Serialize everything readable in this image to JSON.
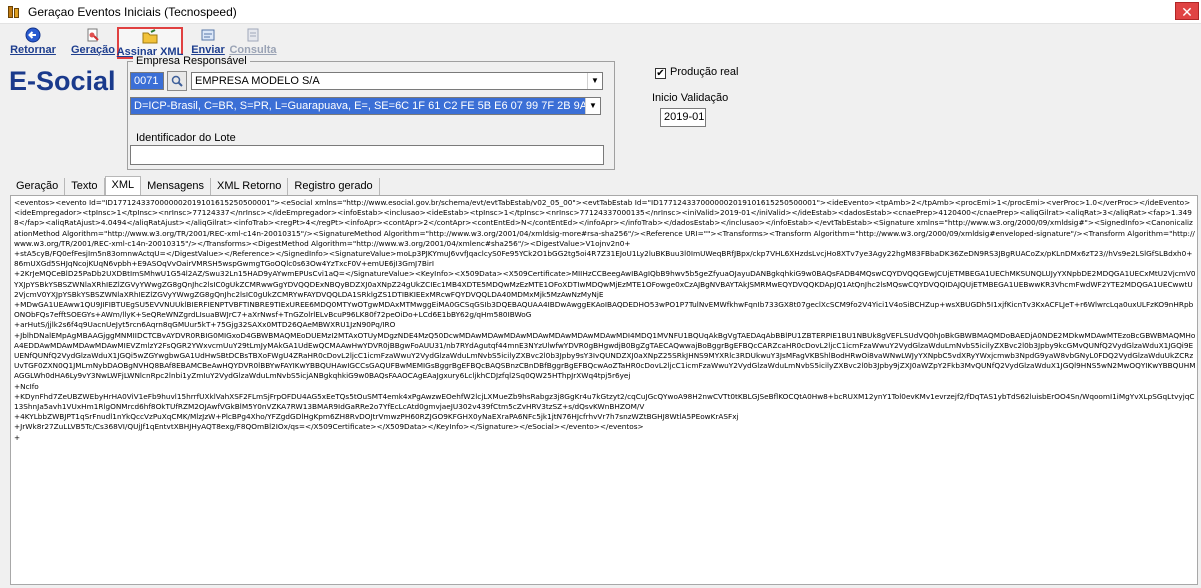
{
  "window": {
    "title": "Geraçao Eventos Iniciais (Tecnospeed)",
    "close_glyph": "✕"
  },
  "toolbar": {
    "buttons": [
      {
        "label": "Retornar",
        "icon": "back-arrow-icon",
        "state": "normal"
      },
      {
        "label": "Geração",
        "icon": "generate-icon",
        "state": "normal"
      },
      {
        "label": "Assinar XML",
        "icon": "folder-sign-icon",
        "state": "selected"
      },
      {
        "label": "Enviar",
        "icon": "send-icon",
        "state": "normal"
      },
      {
        "label": "Consulta",
        "icon": "query-icon",
        "state": "disabled"
      }
    ]
  },
  "logo": "E-Social",
  "empresa": {
    "legend": "Empresa Responsável",
    "code": "0071",
    "company": "EMPRESA MODELO S/A",
    "certificate": "D=ICP-Brasil, C=BR, S=PR, L=Guarapuava, E=, SE=6C 1F 61 C2 FE 5B E6 07 99 7F 2B 9A 38 96 B2 BE",
    "lote_label": "Identificador do Lote",
    "lote_value": ""
  },
  "producao": {
    "checked_glyph": "✔",
    "label": "Produção real"
  },
  "inicio": {
    "label": "Inicio Validação",
    "value": "2019-01"
  },
  "tabs": [
    {
      "label": "Geração",
      "active": false
    },
    {
      "label": "Texto",
      "active": false
    },
    {
      "label": "XML",
      "active": true
    },
    {
      "label": "Mensagens",
      "active": false
    },
    {
      "label": "XML Retorno",
      "active": false
    },
    {
      "label": "Registro gerado",
      "active": false
    }
  ],
  "xml_lines": [
    "<eventos><evento Id=\"ID1771243370000002019101615250500001\"><eSocial xmlns=\"http://www.esocial.gov.br/schema/evt/evtTabEstab/v02_05_00\"><evtTabEstab Id=\"ID1771243370000002019101615250500001\"><ideEvento><tpAmb>2</tpAmb><procEmi>1</procEmi><verProc>1.0</verProc></ideEvento><ideEmpregador><tpInsc>1</tpInsc><nrInsc>77124337</nrInsc></ideEmpregador><infoEstab><inclusao><ideEstab><tpInsc>1</tpInsc><nrInsc>77124337000135</nrInsc><iniValid>2019-01</iniValid></ideEstab><dadosEstab><cnaePrep>4120400</cnaePrep><aliqGilrat><aliqRat>3</aliqRat><fap>1.3498</fap><aliqRatAjust>4.0494</aliqRatAjust></aliqGilrat><infoTrab><regPt>4</regPt><infoApr><contApr>2</contApr><contEntEd>N</contEntEd></infoApr></infoTrab></dadosEstab></inclusao></infoEstab></evtTabEstab><Signature xmlns=\"http://www.w3.org/2000/09/xmldsig#\"><SignedInfo><CanonicalizationMethod Algorithm=\"http://www.w3.org/TR/2001/REC-xml-c14n-20010315\"/><SignatureMethod Algorithm=\"http://www.w3.org/2001/04/xmldsig-more#rsa-sha256\"/><Reference URI=\"\"><Transforms><Transform Algorithm=\"http://www.w3.org/2000/09/xmldsig#enveloped-signature\"/><Transform Algorithm=\"http://www.w3.org/TR/2001/REC-xml-c14n-20010315\"/></Transforms><DigestMethod Algorithm=\"http://www.w3.org/2001/04/xmlenc#sha256\"/><DigestValue>V1ojnv2n0+",
    "+stA5cyB/FQ0efFesjIm5n83omnwActqU=</DigestValue></Reference></SignedInfo><SignatureValue>moLp3PJKYmuJ6vvfJqaclcyS0Fe95YCk2O1bGG2tg5oi4R7Z31EJoU1Ly2luBKBuu3l0ImUWeqBRfJBpx/ckp7VHL6XHzdsLvcjHo8XTv7ye3Agy22hgM83FBbaDK36ZeDN9RS3JBgRUACoZx/pKLnDMx6zT23//hVs9e2LSlGfSLBdxh0+86mUXGd5SHJqNcojKUqN6vpbh+E9ASOqVvOairVMRSH5wspGwmgTGoOQlc0s63Ow4YzTxcF0V+emUE6jI3GmJ7BirI",
    "+2KrJeMQCeBlD25PaDb2UXDBtImSMhwU1G54l2AZ/Swu32Ln15HAD9yAYwmEPUsCvi1aQ=</SignatureValue><KeyInfo><X509Data><X509Certificate>MIIHzCCBeegAwIBAgIQbB9hwv5b5geZfyuaOJayuDANBgkqhkiG9w0BAQsFADB4MQswCQYDVQQGEwJCUjETMBEGA1UEChMKSUNQLUJyYXNpbDE2MDQGA1UECxMtU2VjcmV0YXJpYSBkYSBSZWNlaXRhIEZlZGVyYWwgZG8gQnJhc2lsIC0gUkZCMRwwGgYDVQQDExNBQyBDZXJ0aXNpZ24gUkZCIEc1MB4XDTE5MDQwMzEzMTE1OFoXDTIwMDQwMjEzMTE1OFowge0xCzAJBgNVBAYTAkJSMRMwEQYDVQQKDApJQ1AtQnJhc2lsMQswCQYDVQQIDAJQUjETMBEGA1UEBwwKR3VhcmFwdWF2YTE2MDQGA1UECwwtU2VjcmV0YXJpYSBkYSBSZWNlaXRhIEZlZGVyYWwgZG8gQnJhc2lsIC0gUkZCMRYwFAYDVQQLDA1SRklgZS1DTIBKIEExMRcwFQYDVQQLDA40MDMxMjk5MzAwNzMyNjE",
    "+MDwGA1UEAww1QU9JIFIBTUEgSU5EVVNUUklBIERFIENPTVBFTINBRE9TIExUREE6MDQ0MTYwOTgwMDAxMTMwggEiMA0GCSqGSIb3DQEBAQUAA4IBDwAwggEKAoIBAQDEDHO53wPO1P7TulNvEMWfkhwFqnIb733GX8t07geclXcSCM9fo2V4Yici1V4oSiBCHZup+wsXBUGDh5I1xjfKicnTv3KxACFLJeT+r6WlwrcLqa0uxULFzKO9nHRpbONObFQs7efftSOEGYs+AWm/llyK+SeQReWNZgrdLIsuaBWJrC7+aXrNwsf+TnGZolrlELvBcuP96LK80f72peOiDo+LCd6E1bBY62g/qHm580IBWoG",
    "+arHutS/jjlk2s6f4q9UacnUeJyt5rcn6Aqrn8qGMUur5kT+75Gjg32SAXx0MTD26QAeMBWXRU1JzN90Pq/IRO",
    "+JblhDNalEMpAgMBAAGjggMNMIIDCTCBvAYDVR0RBIG0MIGxoD4GBWBMAQMEoDUEMzI2MTAxOTUyMDgzNDE4MzQ50DcwMDAwMDAwMDAwMDAwMDAwMDAwMDAwMDI4MDQ1MVNFU1BQUqAkBgVgTAEDAqAbBBlPU1ZBTERPIE1BU1NBUk8gVEFLSUdVQ0hJoBkGBWBMAQMDoBAEDjA0NDE2MDkwMDAwMTEzoBcGBWBMAQMHoA4EDDAwMDAwMDAwMDAwMIEVZmlzY2FsQGR2YWxvcmUuY29tLmJyMAkGA1UdEwQCMAAwHwYDVR0jBBgwFoAUU31/nb7RYdAgutqf44mnE3NYzUlwfwYDVR0gBHgwdjB0BgZgTAECAQwwajBoBggrBgEFBQcCARZcaHR0cDovL2ljcC1icmFzaWwuY2VydGlzaWduLmNvbS5icilyZXBvc2l0b3Jpby9kcGMvQUNfQ2VydGlzaWduX1JGQi9EUENfQUNfQ2VydGlzaWduX1JGQi5wZGYwgbwGA1UdHwSBtDCBsTBXoFWgU4ZRaHR0cDovL2ljcC1icmFzaWwuY2VydGlzaWduLmNvbS5icilyZXBvc2l0b3Jpby9sY3IvQUNDZXJ0aXNpZ25SRkJHNS9MYXRlc3RDUkwuY3JsMFagVKBShlBodHRwOi8vaWNwLWJyYXNpbC5vdXRyYWxjcmwb3NpdG9yaW8vbGNyL0FDQ2VydGlzaWduUkZCRzUvTGF0ZXN0Q1JMLmNybDAOBgNVHQ8BAf8EBAMCBeAwHQYDVR0lBBYwFAYIKwYBBQUHAwIGCCsGAQUFBwMEMIGsBggrBgEFBQcBAQSBnzCBnDBfBggrBgEFBQcwAoZTaHR0cDovL2ljcC1icmFzaWwuY2VydGlzaWduLmNvbS5icilyZXBvc2l0b3Jpby9jZXJ0aWZpY2Fkb3MvQUNfQ2VydGlzaWduX1JGQl9HNS5wN2MwOQYIKwYBBQUHMAGGLWh0dHA6Ly9vY3NwLWFjLWNlcnRpc2lnbi1yZmIuY2VydGlzaWduLmNvbS5icjANBgkqhkiG9w0BAQsFAAOCAgEAaJgxury6LcljkhCDJzfql2Sq0QW25HThpJrXWq4tpj5r6yej",
    "+NcIfo",
    "+KDynFhd7ZeUBZWEbyHrHA0ViV1eFb9huvl15hrrfUXklVahXSF2FLmSjFrpOFDU4AG5xEeTQs5tOuSMT4emk4xPgAwzwEOehfW2lcjLXMueZb9hsRabgz3j8GgKr4u7kGtzyt2/cqCuJGcQYwoA98H2nwCVTt0tKBLGJSeBflKOCQtA0Hw8+bcRUXM12ynY1Tol0evKMv1evrzejf2/fDqTAS1ybTdS62luisbErOO4Sn/WqoomI1iMgYvXLpSGqLtvyjqC13ShnJa5avh1VUxHm1RlgONMrcd6hf8OkTUfRZM2OJAwfVGkBlM5Y0nVZKA7RW13BMAR9IdGaRRe2o7YfEcLcAtd0gmvjaeJU302v439fCtm5cZvHRV3tzSZ+s/dQsvKWnBHZOM/V",
    "+4KYLbbZWBJPT1qSrFnudl1nYkQccVzPuXqCMK/MlzJzW+PlcBPg4Xho/YFZgdGDlHgKpm6ZH8RvDOJtrVmwzPH60RZJGO9KFGHX0yNaEXraPA6NFc5jk1jtN76HJcfrhvVr7h7snzWZtBGHJ8WtlA5PEowKrASFxj",
    "+JrWk8r27ZuLLVB5Tc/Cs368VI/QUjJf1qEntvtXBHJHyAQT8exg/F8QOmBl2IOx/qs=</X509Certificate></X509Data></KeyInfo></Signature></eSocial></evento></eventos>",
    "+"
  ]
}
